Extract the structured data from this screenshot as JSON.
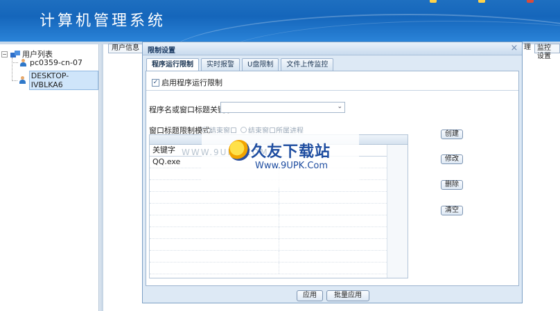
{
  "app": {
    "title": "计算机管理系统"
  },
  "sidebar": {
    "root_label": "用户列表",
    "items": [
      {
        "label": "pc0359-cn-07"
      },
      {
        "label": "DESKTOP-IVBLKA6"
      }
    ]
  },
  "background_tabs": {
    "user_info": "用户信息",
    "manage": "理",
    "monitor_settings": "监控设置"
  },
  "dialog": {
    "title": "限制设置",
    "close": "×",
    "tabs": [
      "程序运行限制",
      "实时报警",
      "U盘限制",
      "文件上传监控"
    ],
    "enable_label": "启用程序运行限制",
    "enable_checked": true,
    "keyword_label": "程序名或窗口标题关键字:",
    "keyword_value": "",
    "mode_label": "窗口标题限制模式:",
    "mode_options": [
      "结束窗口",
      "结束窗口所属进程"
    ],
    "grid": {
      "header": "关键字",
      "rows": [
        "QQ.exe",
        "",
        "",
        "",
        "",
        "",
        "",
        "",
        "",
        ""
      ]
    },
    "buttons": {
      "create": "创建",
      "modify": "修改",
      "delete": "删除",
      "clear": "清空"
    },
    "footer": {
      "apply": "应用",
      "batch_apply": "批量应用"
    }
  },
  "watermark": {
    "url": "WWW.9UPK.COM",
    "name": "久友下载站",
    "site": "Www.9UPK.Com"
  },
  "colors": {
    "header_blue": "#1e6fc0",
    "dialog_bg": "#dde9f5",
    "selected": "#cfe5fa"
  }
}
